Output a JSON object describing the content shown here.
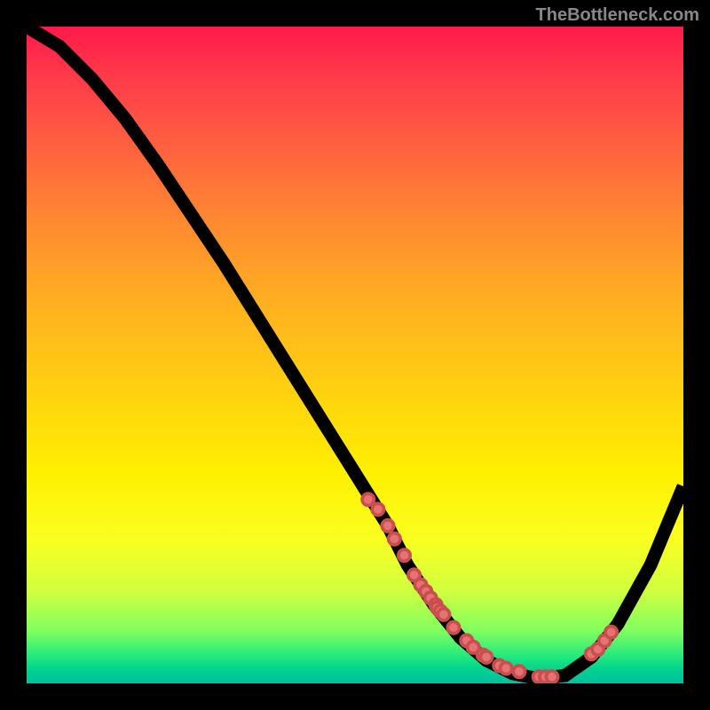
{
  "watermark": "TheBottleneck.com",
  "chart_data": {
    "type": "line",
    "title": "",
    "xlabel": "",
    "ylabel": "",
    "xlim": [
      0,
      100
    ],
    "ylim": [
      0,
      100
    ],
    "curve": {
      "x": [
        0,
        5,
        10,
        15,
        20,
        25,
        30,
        35,
        40,
        45,
        50,
        55,
        58,
        62,
        66,
        70,
        74,
        78,
        82,
        86,
        90,
        95,
        100
      ],
      "y": [
        100,
        97,
        92,
        86,
        79,
        71.5,
        64,
        56,
        48,
        40,
        32,
        24,
        18,
        12,
        7,
        3.5,
        1.5,
        0.7,
        1.2,
        4,
        9,
        18,
        30
      ]
    },
    "scatter_points": {
      "x": [
        52,
        53.5,
        55,
        56,
        57.5,
        59,
        60,
        60.8,
        61.5,
        62.3,
        62.5,
        63,
        63.5,
        65,
        67,
        68,
        69.5,
        70,
        72,
        73,
        75,
        78,
        79,
        80,
        86,
        87,
        88,
        89
      ],
      "y": [
        28,
        26.5,
        24,
        22,
        19.5,
        16.5,
        15,
        14,
        13,
        12,
        11.5,
        11,
        10.5,
        8.5,
        6.5,
        5.5,
        4.3,
        4,
        2.7,
        2.3,
        1.8,
        1,
        1,
        1,
        4.5,
        5.2,
        6.5,
        7.8
      ]
    },
    "gradient": {
      "direction": "vertical",
      "stops": [
        {
          "pos": 0.0,
          "color": "#ff1a4a"
        },
        {
          "pos": 0.18,
          "color": "#ff6040"
        },
        {
          "pos": 0.42,
          "color": "#ffb020"
        },
        {
          "pos": 0.68,
          "color": "#fff000"
        },
        {
          "pos": 0.86,
          "color": "#d0ff40"
        },
        {
          "pos": 0.96,
          "color": "#20e880"
        },
        {
          "pos": 1.0,
          "color": "#00c0a0"
        }
      ]
    },
    "dot_fill": "#e57373",
    "dot_stroke": "#c94f4f"
  }
}
